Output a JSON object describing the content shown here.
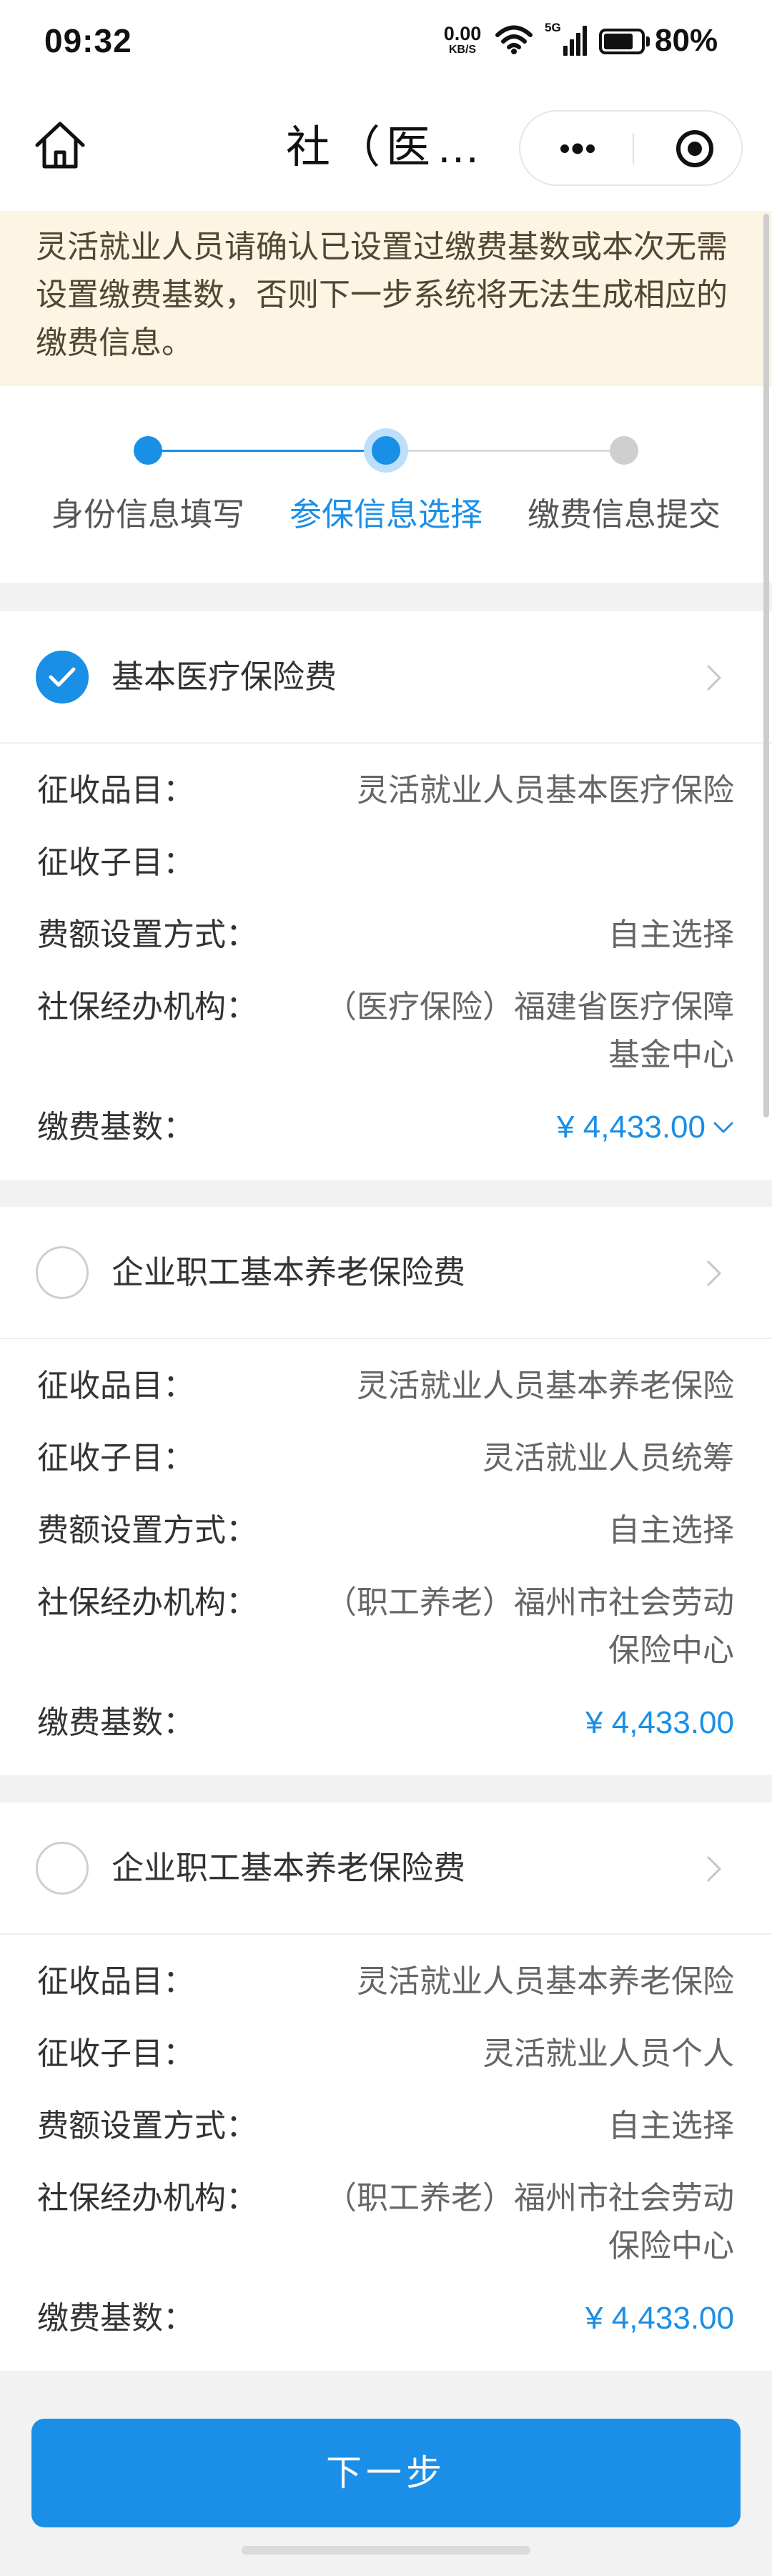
{
  "status_bar": {
    "time": "09:32",
    "net_speed": "0.00",
    "net_unit": "KB/S",
    "network_type": "5G",
    "battery": "80%",
    "battery_level": 0.8,
    "icons": [
      "wifi-icon",
      "cellular-signal-icon",
      "battery-icon"
    ]
  },
  "nav": {
    "title": "社（医…",
    "icons": {
      "home": "home-icon",
      "more": "more-icon",
      "target": "target-icon"
    }
  },
  "notice": {
    "text": "灵活就业人员请确认已设置过缴费基数或本次无需设置缴费基数，否则下一步系统将无法生成相应的缴费信息。"
  },
  "steps": [
    {
      "label": "身份信息填写",
      "status": "completed"
    },
    {
      "label": "参保信息选择",
      "status": "current"
    },
    {
      "label": "缴费信息提交",
      "status": "pending"
    }
  ],
  "cards": [
    {
      "title": "基本医疗保险费",
      "checked": true,
      "rows": [
        {
          "label": "征收品目：",
          "value": "灵活就业人员基本医疗保险"
        },
        {
          "label": "征收子目：",
          "value": ""
        },
        {
          "label": "费额设置方式：",
          "value": "自主选择"
        },
        {
          "label": "社保经办机构：",
          "value": "（医疗保险）福建省医疗保障基金中心"
        }
      ],
      "base": {
        "label": "缴费基数：",
        "value": "¥ 4,433.00",
        "icon": "chevron-down-icon"
      }
    },
    {
      "title": "企业职工基本养老保险费",
      "checked": false,
      "rows": [
        {
          "label": "征收品目：",
          "value": "灵活就业人员基本养老保险"
        },
        {
          "label": "征收子目：",
          "value": "灵活就业人员统筹"
        },
        {
          "label": "费额设置方式：",
          "value": "自主选择"
        },
        {
          "label": "社保经办机构：",
          "value": "（职工养老）福州市社会劳动保险中心"
        }
      ],
      "base": {
        "label": "缴费基数：",
        "value": "¥ 4,433.00"
      }
    },
    {
      "title": "企业职工基本养老保险费",
      "checked": false,
      "rows": [
        {
          "label": "征收品目：",
          "value": "灵活就业人员基本养老保险"
        },
        {
          "label": "征收子目：",
          "value": "灵活就业人员个人"
        },
        {
          "label": "费额设置方式：",
          "value": "自主选择"
        },
        {
          "label": "社保经办机构：",
          "value": "（职工养老）福州市社会劳动保险中心"
        }
      ],
      "base": {
        "label": "缴费基数：",
        "value": "¥ 4,433.00"
      }
    }
  ],
  "footer": {
    "next_button": "下一步"
  },
  "colors": {
    "primary": "#1a8fe6",
    "notice_background": "#fdf5e3",
    "page_background": "#f2f2f2",
    "step_pending": "#cfcfcf"
  }
}
